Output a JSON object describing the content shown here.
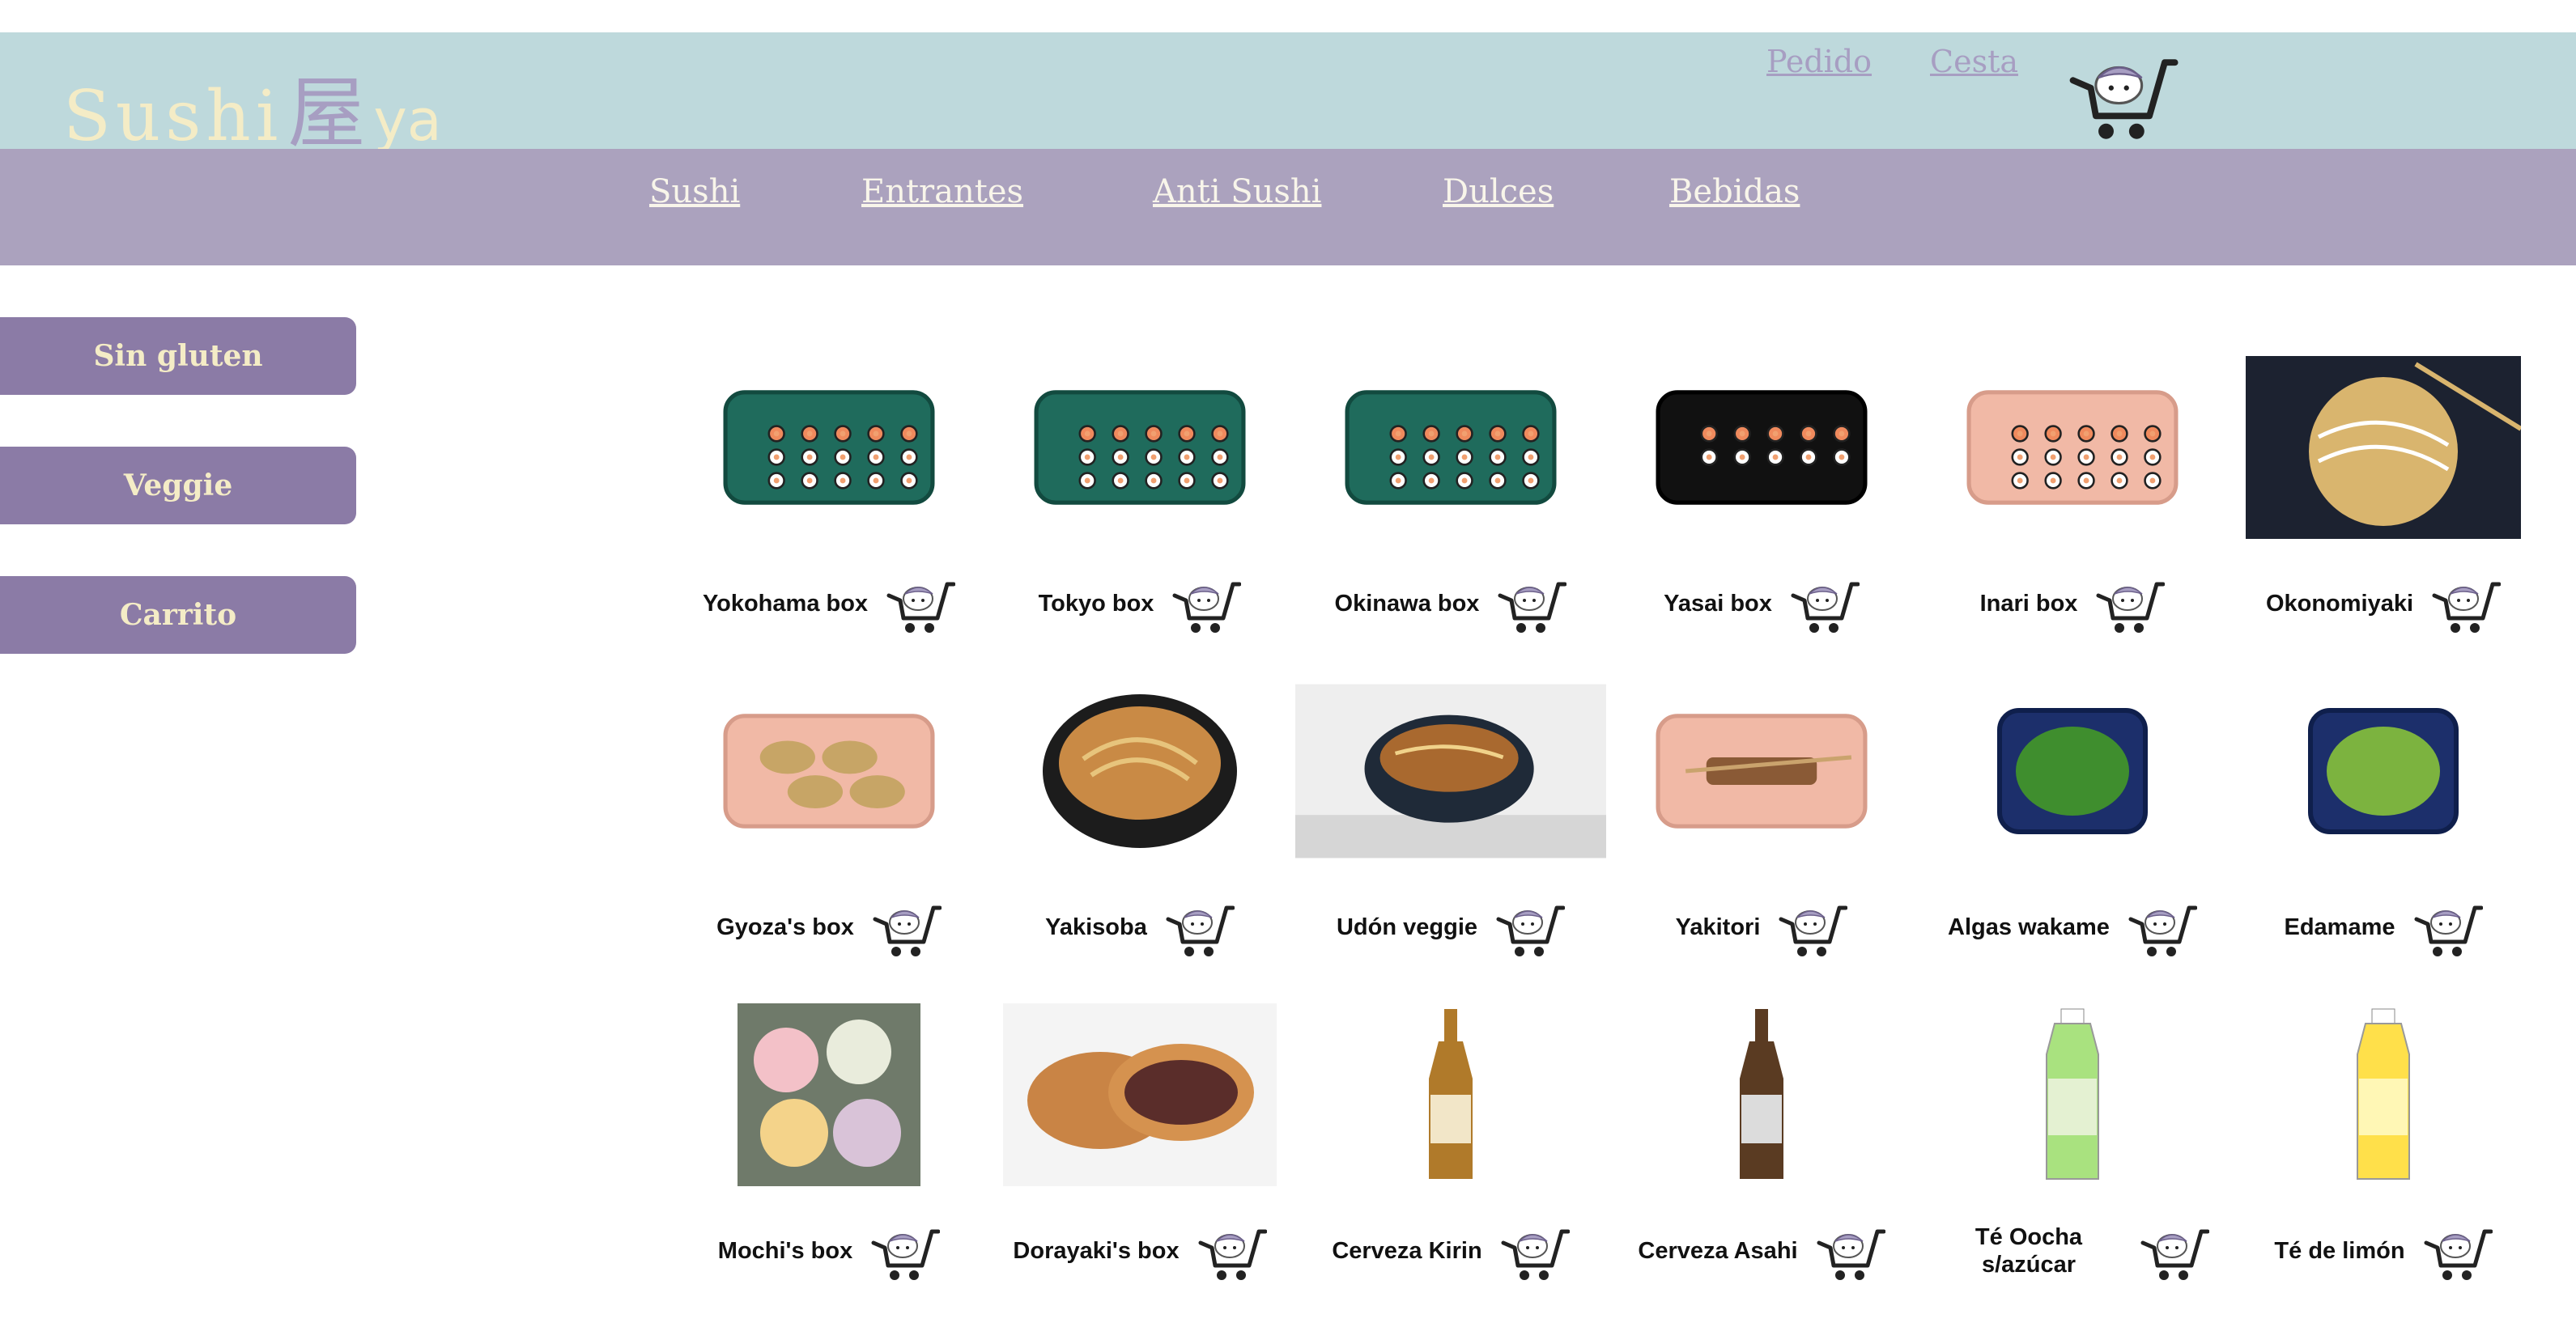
{
  "brand": {
    "main": "Sushi",
    "kanji": "屋",
    "suffix": "ya",
    "cream": "#f4ecc6",
    "lavender": "#a79ec2"
  },
  "topnav": {
    "pedido": "Pedido",
    "cesta": "Cesta",
    "cart_icon": "cart-mascot-icon"
  },
  "menu": {
    "sushi": "Sushi",
    "entrantes": "Entrantes",
    "anti_sushi": "Anti Sushi",
    "dulces": "Dulces",
    "bebidas": "Bebidas"
  },
  "sidebar": {
    "sin_gluten": "Sin gluten",
    "veggie": "Veggie",
    "carrito": "Carrito"
  },
  "colors": {
    "header_bg": "#bed9dc",
    "nav_bg": "#aba2be",
    "sidebar_btn": "#8b7ba6"
  },
  "products": [
    {
      "name": "Yokohama box",
      "image": "sushi-tray-green"
    },
    {
      "name": "Tokyo box",
      "image": "sushi-tray-green"
    },
    {
      "name": "Okinawa box",
      "image": "sushi-tray-green"
    },
    {
      "name": "Yasai box",
      "image": "sushi-tray-black"
    },
    {
      "name": "Inari box",
      "image": "sushi-tray-pink"
    },
    {
      "name": "Okonomiyaki",
      "image": "okonomiyaki-plate"
    },
    {
      "name": "Gyoza's box",
      "image": "gyoza-tray-pink"
    },
    {
      "name": "Yakisoba",
      "image": "noodle-bowl"
    },
    {
      "name": "Udón veggie",
      "image": "udon-bowl"
    },
    {
      "name": "Yakitori",
      "image": "yakitori-tray-pink"
    },
    {
      "name": "Algas wakame",
      "image": "wakame-tray-blue"
    },
    {
      "name": "Edamame",
      "image": "edamame-tray-blue"
    },
    {
      "name": "Mochi's box",
      "image": "mochi-photo"
    },
    {
      "name": "Dorayaki's box",
      "image": "dorayaki-photo"
    },
    {
      "name": "Cerveza Kirin",
      "image": "beer-bottle-kirin"
    },
    {
      "name": "Cerveza Asahi",
      "image": "beer-bottle-asahi"
    },
    {
      "name": "Té Oocha s/azúcar",
      "image": "green-tea-bottle"
    },
    {
      "name": "Té de limón",
      "image": "lemon-tea-bottle"
    }
  ]
}
